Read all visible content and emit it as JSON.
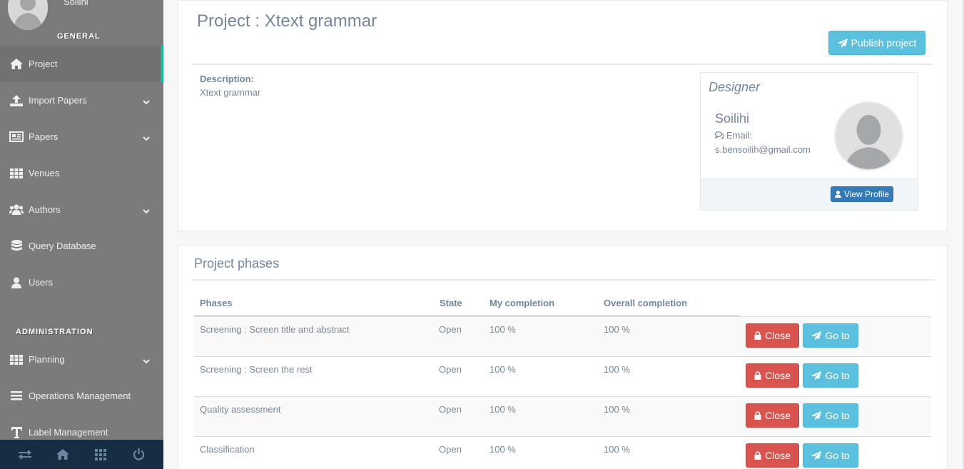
{
  "sidebar": {
    "profile_name": "Soilihi",
    "general_title": "GENERAL",
    "admin_title": "ADMINISTRATION",
    "items": [
      {
        "label": "Project",
        "icon": "home-icon"
      },
      {
        "label": "Import Papers",
        "icon": "upload-icon"
      },
      {
        "label": "Papers",
        "icon": "newspaper-icon"
      },
      {
        "label": "Venues",
        "icon": "table-icon"
      },
      {
        "label": "Authors",
        "icon": "users-icon"
      },
      {
        "label": "Query Database",
        "icon": "database-icon"
      },
      {
        "label": "Users",
        "icon": "user-icon"
      }
    ],
    "admin_items": [
      {
        "label": "Planning",
        "icon": "table-icon"
      },
      {
        "label": "Operations Management",
        "icon": "bars-icon"
      },
      {
        "label": "Label Management",
        "icon": "text-icon"
      }
    ],
    "footer_icons": [
      "exchange-icon",
      "home-icon",
      "grid-icon",
      "power-icon"
    ]
  },
  "project": {
    "title": "Project : Xtext grammar",
    "publish_label": "Publish project",
    "description_label": "Description:",
    "description": "Xtext grammar"
  },
  "designer": {
    "heading": "Designer",
    "name": "Soilihi",
    "email_label": "Email:",
    "email": "s.bensoilih@gmail.com",
    "view_profile_label": "View Profile"
  },
  "phases": {
    "title": "Project phases",
    "headers": [
      "Phases",
      "State",
      "My completion",
      "Overall completion"
    ],
    "close_label": "Close",
    "goto_label": "Go to",
    "rows": [
      {
        "name": "Screening : Screen title and abstract",
        "state": "Open",
        "my": "100 %",
        "overall": "100 %"
      },
      {
        "name": "Screening : Screen the rest",
        "state": "Open",
        "my": "100 %",
        "overall": "100 %"
      },
      {
        "name": "Quality assessment",
        "state": "Open",
        "my": "100 %",
        "overall": "100 %"
      },
      {
        "name": "Classification",
        "state": "Open",
        "my": "100 %",
        "overall": "100 %"
      }
    ]
  },
  "colors": {
    "sidebar_bg": "#7b7b7b",
    "sidebar_footer": "#172d44",
    "active_accent": "#1abb9c",
    "info": "#5bc0de",
    "danger": "#d9534f",
    "primary": "#337ab7"
  }
}
